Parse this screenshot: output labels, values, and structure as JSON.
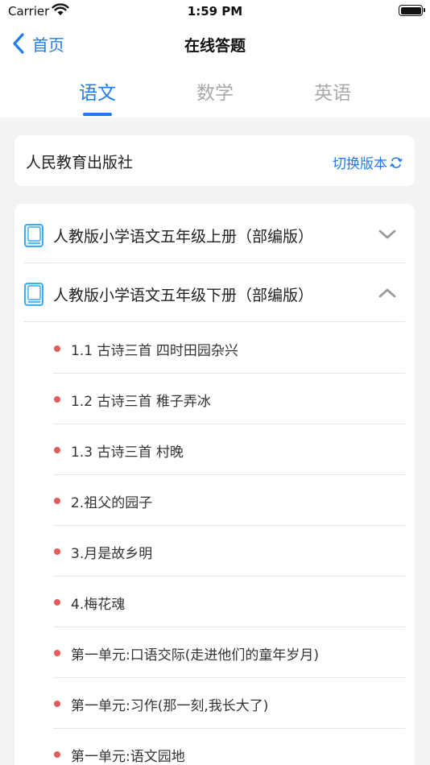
{
  "status_bar": {
    "carrier": "Carrier",
    "time": "1:59 PM"
  },
  "nav": {
    "back_label": "首页",
    "title": "在线答题"
  },
  "tabs": [
    {
      "label": "语文",
      "active": true
    },
    {
      "label": "数学",
      "active": false
    },
    {
      "label": "英语",
      "active": false
    }
  ],
  "publisher": {
    "name": "人民教育出版社",
    "switch_label": "切换版本"
  },
  "books": [
    {
      "title": "人教版小学语文五年级上册（部编版）",
      "expanded": false
    },
    {
      "title": "人教版小学语文五年级下册（部编版）",
      "expanded": true
    }
  ],
  "lessons": [
    {
      "title": "1.1 古诗三首 四时田园杂兴"
    },
    {
      "title": "1.2 古诗三首 稚子弄冰"
    },
    {
      "title": "1.3 古诗三首 村晚"
    },
    {
      "title": "2.祖父的园子"
    },
    {
      "title": "3.月是故乡明"
    },
    {
      "title": "4.梅花魂"
    },
    {
      "title": "第一单元:口语交际(走进他们的童年岁月)"
    },
    {
      "title": "第一单元:习作(那一刻,我长大了)"
    },
    {
      "title": "第一单元:语文园地"
    }
  ],
  "colors": {
    "accent": "#1f7cf0",
    "bullet": "#e35b5b",
    "background": "#f2f3f5"
  },
  "icons": {
    "back": "chevron-left-icon",
    "switch": "refresh-icon",
    "book": "book-icon",
    "collapsed": "chevron-down-icon",
    "expanded": "chevron-up-icon"
  }
}
